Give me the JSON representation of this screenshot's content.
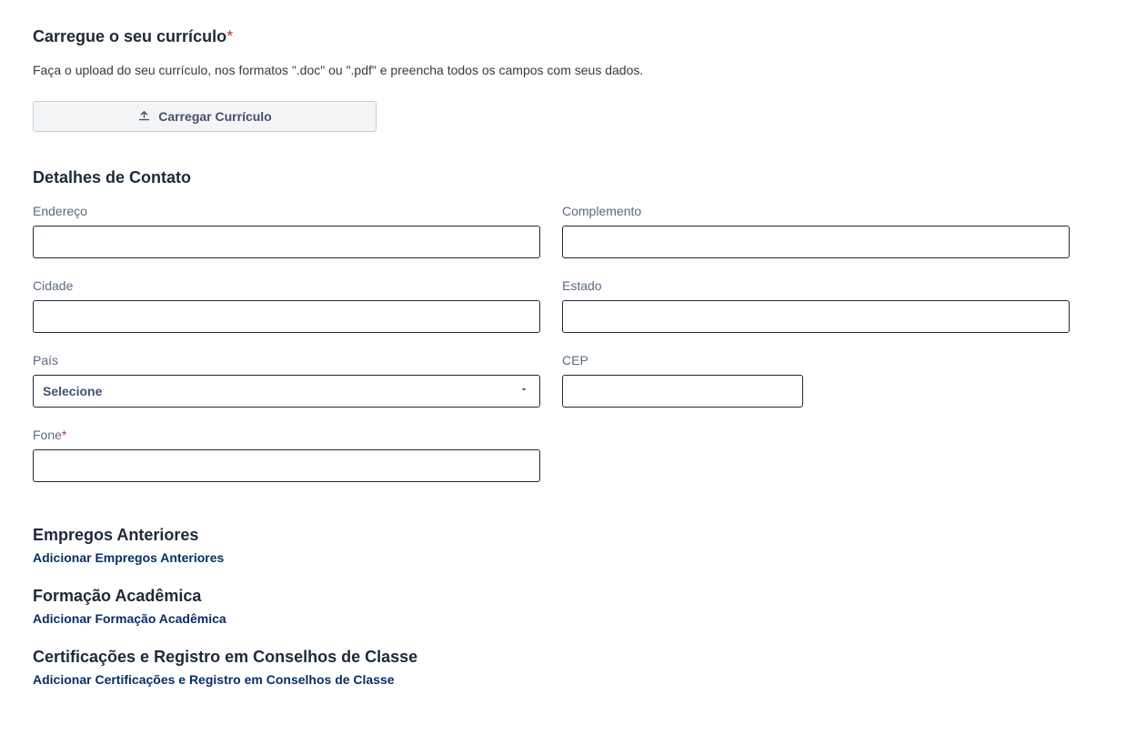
{
  "upload": {
    "title": "Carregue o seu currículo",
    "helper": "Faça o upload do seu currículo, nos formatos \".doc\" ou \".pdf\" e preencha todos os campos com seus dados.",
    "button": "Carregar Currículo"
  },
  "contact": {
    "title": "Detalhes de Contato",
    "address_label": "Endereço",
    "complement_label": "Complemento",
    "city_label": "Cidade",
    "state_label": "Estado",
    "country_label": "País",
    "country_placeholder": "Selecione",
    "cep_label": "CEP",
    "phone_label": "Fone"
  },
  "jobs": {
    "title": "Empregos Anteriores",
    "add": "Adicionar Empregos Anteriores"
  },
  "education": {
    "title": "Formação Acadêmica",
    "add": "Adicionar Formação Acadêmica"
  },
  "certs": {
    "title": "Certificações e Registro em Conselhos de Classe",
    "add": "Adicionar Certificações e Registro em Conselhos de Classe"
  }
}
